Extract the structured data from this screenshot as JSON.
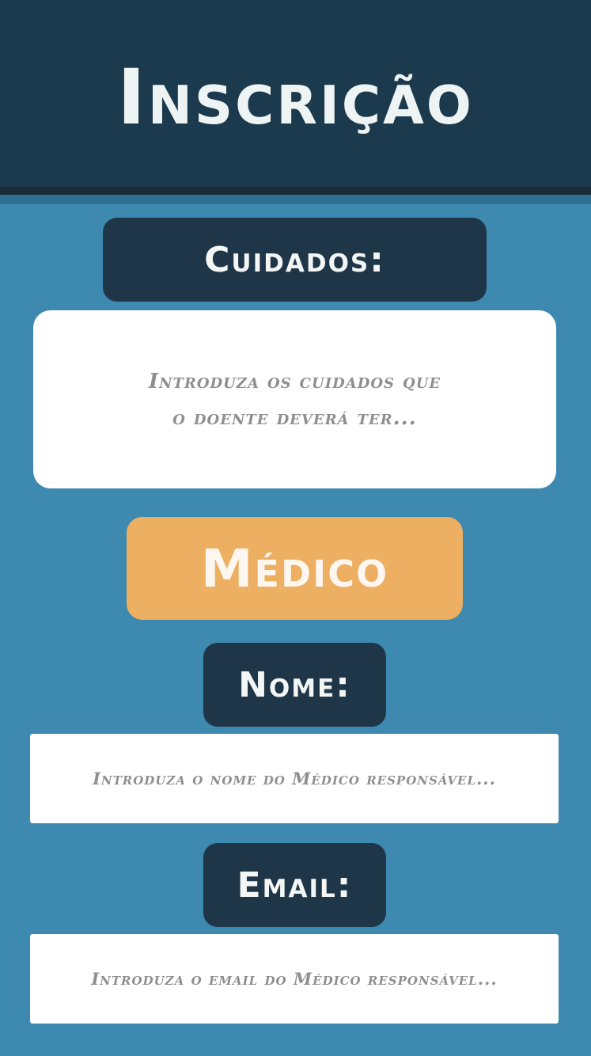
{
  "header": {
    "title": "Inscrição"
  },
  "cuidados": {
    "label": "Cuidados:",
    "placeholder_line1": "Introduza os cuidados que",
    "placeholder_line2": "o doente deverá ter..."
  },
  "medico_section": {
    "label": "Médico"
  },
  "nome": {
    "label": "Nome:",
    "placeholder": "Introduza o nome do Médico responsável..."
  },
  "email": {
    "label": "Email:",
    "placeholder": "Introduza o email do Médico responsável..."
  },
  "colors": {
    "header_bg": "#1c3a4d",
    "page_bg": "#3d89b0",
    "label_bg": "#1f3649",
    "accent": "#edaf62",
    "field_bg": "#ffffff",
    "placeholder": "#8f8f8f"
  }
}
